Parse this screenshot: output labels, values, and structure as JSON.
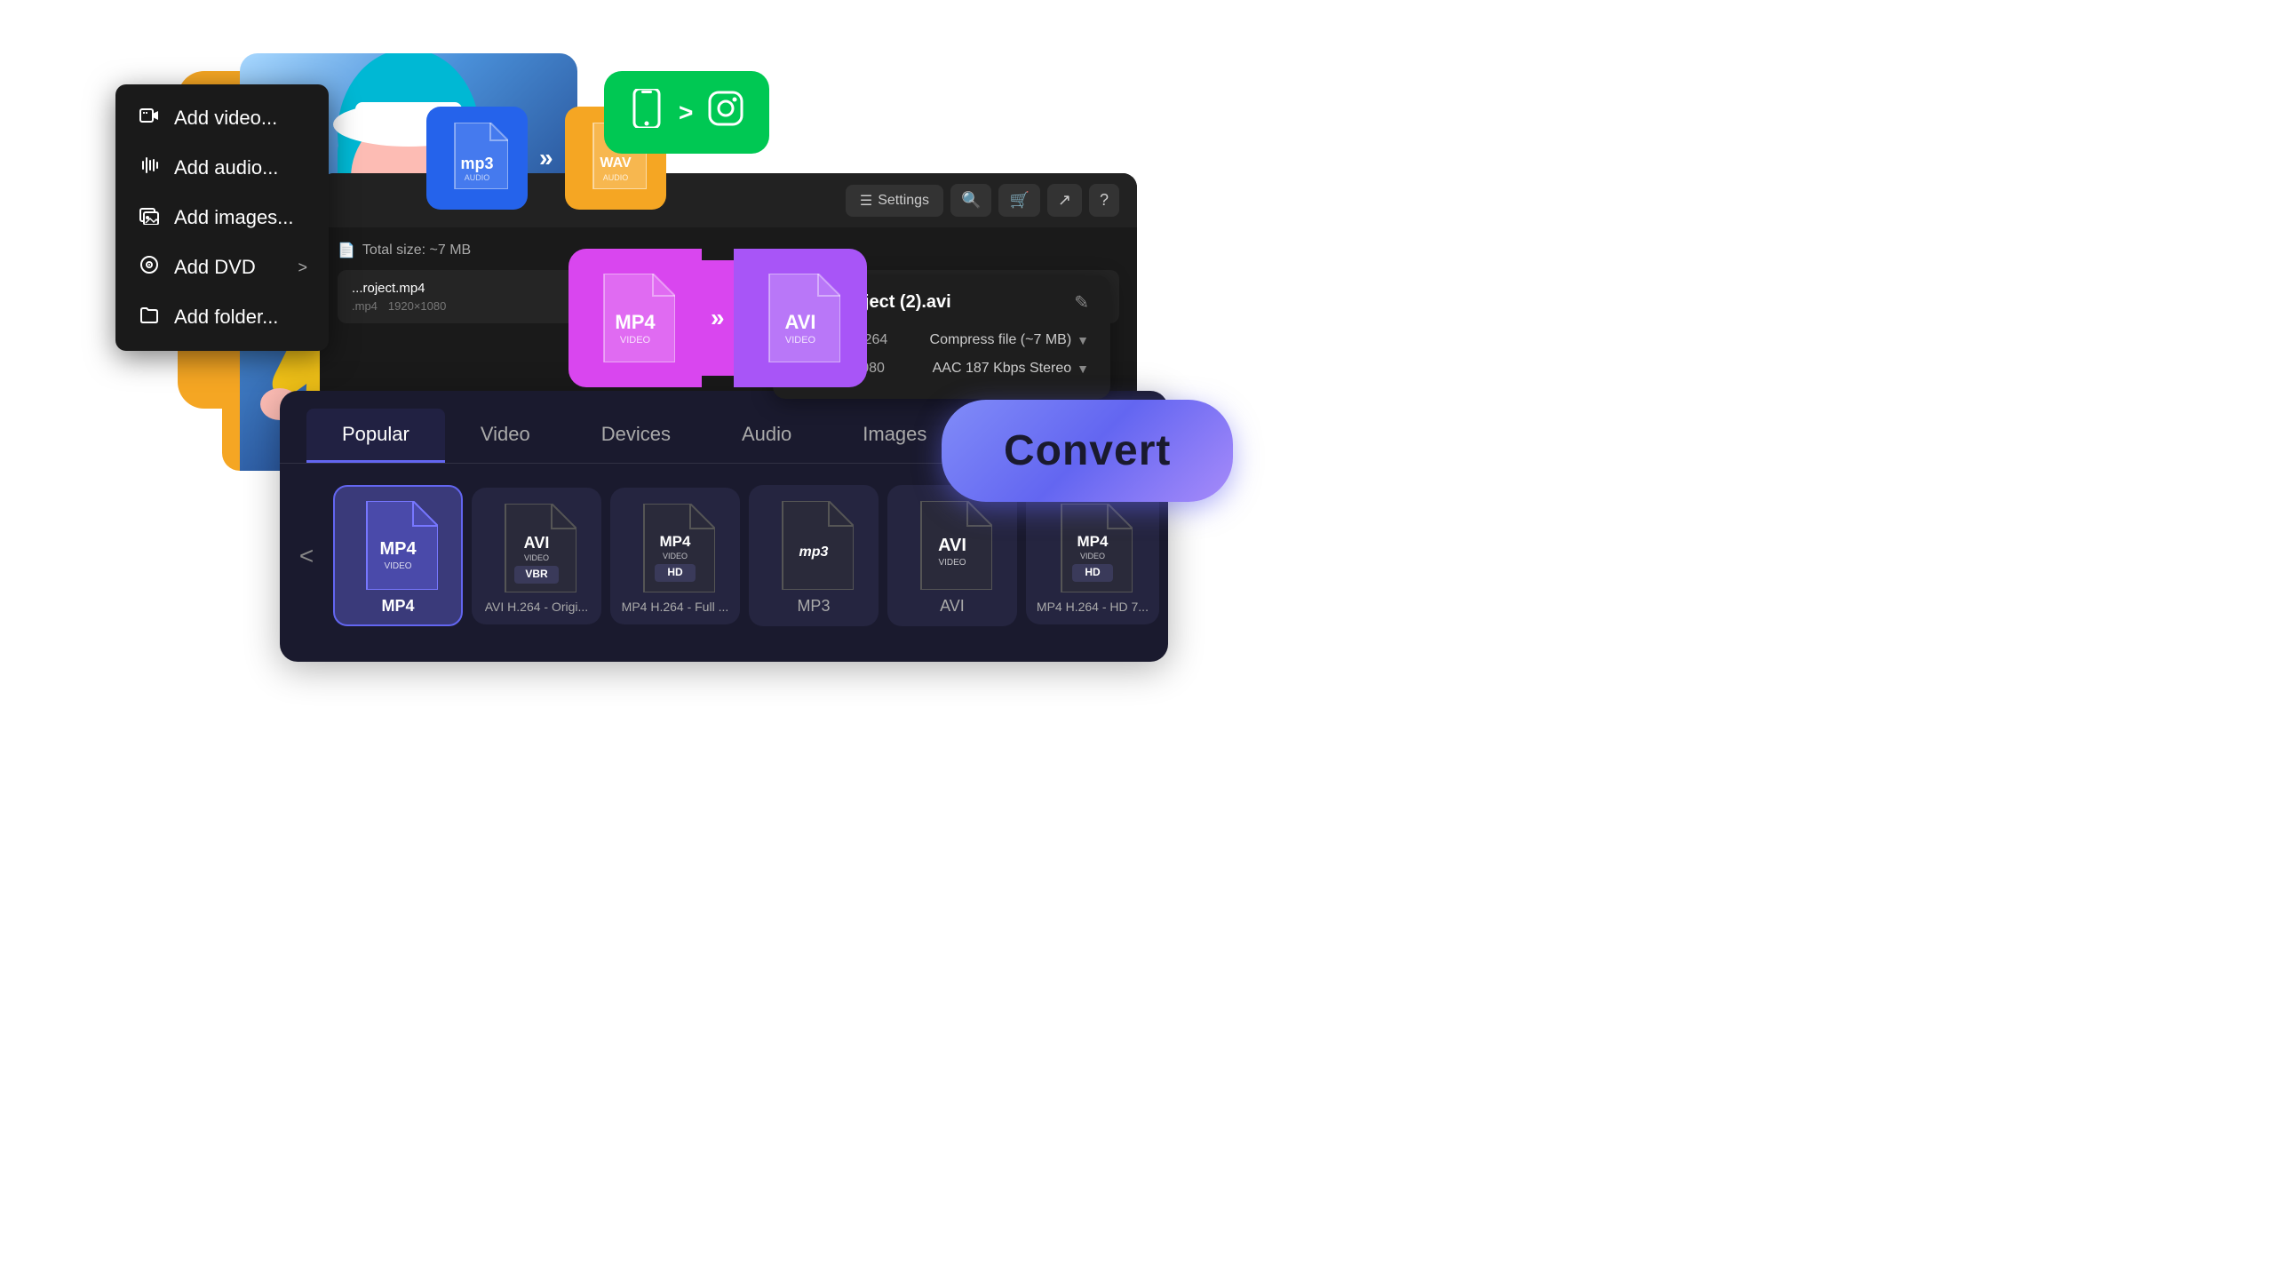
{
  "orange_blob": {},
  "mp3_wav_badge": {
    "from_format": "mp3",
    "from_sub": "",
    "to_format": "WAV",
    "to_sub": "",
    "arrow": "»"
  },
  "iphone_insta_badge": {
    "arrow": ">"
  },
  "context_menu": {
    "items": [
      {
        "id": "add-video",
        "icon": "▦",
        "label": "Add video..."
      },
      {
        "id": "add-audio",
        "icon": "♫",
        "label": "Add audio..."
      },
      {
        "id": "add-images",
        "icon": "⊡",
        "label": "Add images..."
      },
      {
        "id": "add-dvd",
        "icon": "⊙",
        "label": "Add DVD",
        "arrow": ">"
      },
      {
        "id": "add-folder",
        "icon": "⊟",
        "label": "Add folder..."
      }
    ]
  },
  "app_toolbar": {
    "settings_label": "Settings",
    "search_icon": "🔍",
    "cart_icon": "🛒",
    "share_icon": "↗",
    "help_icon": "?"
  },
  "app_header": {
    "total_size_label": "Total size: ~7 MB",
    "file_icon": "📄"
  },
  "mp4_avi_conversion": {
    "from": "MP4",
    "from_sub": "VIDEO",
    "arrow": "»",
    "to": "AVI",
    "to_sub": "VIDEO"
  },
  "project_panel": {
    "title": "New project (2).avi",
    "edit_icon": "✎",
    "rows": [
      {
        "icon": "🎬",
        "label": "avi · H.264",
        "value": "Compress file (~7 MB)",
        "has_dropdown": true
      },
      {
        "icon": "⊞",
        "label": "1920×1080",
        "value": "AAC 187 Kbps Stereo",
        "has_dropdown": true
      }
    ]
  },
  "format_panel": {
    "tabs": [
      {
        "id": "popular",
        "label": "Popular",
        "active": true
      },
      {
        "id": "video",
        "label": "Video",
        "active": false
      },
      {
        "id": "devices",
        "label": "Devices",
        "active": false
      },
      {
        "id": "audio",
        "label": "Audio",
        "active": false
      },
      {
        "id": "images",
        "label": "Images",
        "active": false
      }
    ],
    "nav_prev": "<",
    "nav_next": ">",
    "formats": [
      {
        "id": "mp4",
        "label": "MP4",
        "sublabel": "VIDEO",
        "selected": true,
        "color": "#6366F1",
        "tag": ""
      },
      {
        "id": "avi-h264-orig",
        "label": "AVI H.264 - Origi...",
        "sublabel": "VIDEO VBR",
        "selected": false,
        "color": "#2a2a40",
        "tag": "VBR"
      },
      {
        "id": "mp4-h264-full",
        "label": "MP4 H.264 - Full ...",
        "sublabel": "VIDEO HD",
        "selected": false,
        "color": "#2a2a40",
        "tag": "HD"
      },
      {
        "id": "mp3",
        "label": "MP3",
        "sublabel": "",
        "selected": false,
        "color": "#2a2a40",
        "tag": ""
      },
      {
        "id": "avi",
        "label": "AVI",
        "sublabel": "VIDEO",
        "selected": false,
        "color": "#2a2a40",
        "tag": ""
      },
      {
        "id": "mp4-hd7",
        "label": "MP4 H.264 - HD 7...",
        "sublabel": "VIDEO HD",
        "selected": false,
        "color": "#2a2a40",
        "tag": "HD"
      }
    ]
  },
  "convert_button": {
    "label": "Convert"
  }
}
